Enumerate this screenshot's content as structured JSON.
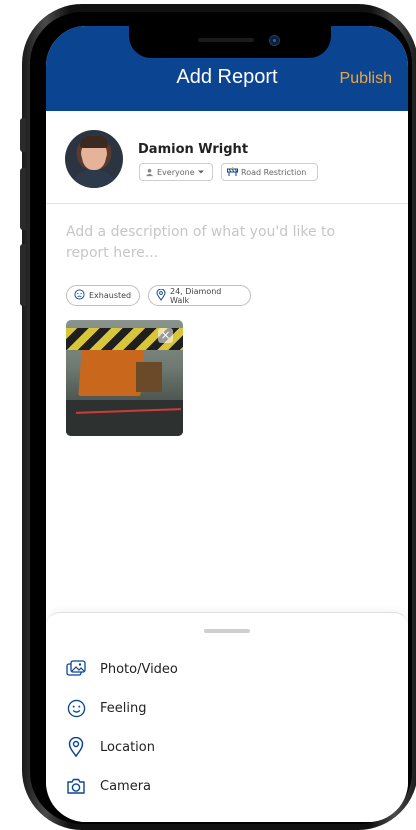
{
  "header": {
    "title": "Add Report",
    "publish_label": "Publish"
  },
  "profile": {
    "name": "Damion Wright",
    "audience_label": "Everyone",
    "category_label": "Road Restriction"
  },
  "composer": {
    "placeholder": "Add a description of what you'd like to report here..."
  },
  "tags": {
    "feeling": "Exhausted",
    "location": "24, Diamond Walk"
  },
  "attachments": [
    {
      "type": "photo",
      "remove_label": "×"
    }
  ],
  "sheet": {
    "options": [
      {
        "label": "Photo/Video",
        "icon": "photo-icon"
      },
      {
        "label": "Feeling",
        "icon": "smiley-icon"
      },
      {
        "label": "Location",
        "icon": "location-pin-icon"
      },
      {
        "label": "Camera",
        "icon": "camera-icon"
      }
    ]
  },
  "colors": {
    "header": "#0b4592",
    "accent": "#f2a53a"
  }
}
